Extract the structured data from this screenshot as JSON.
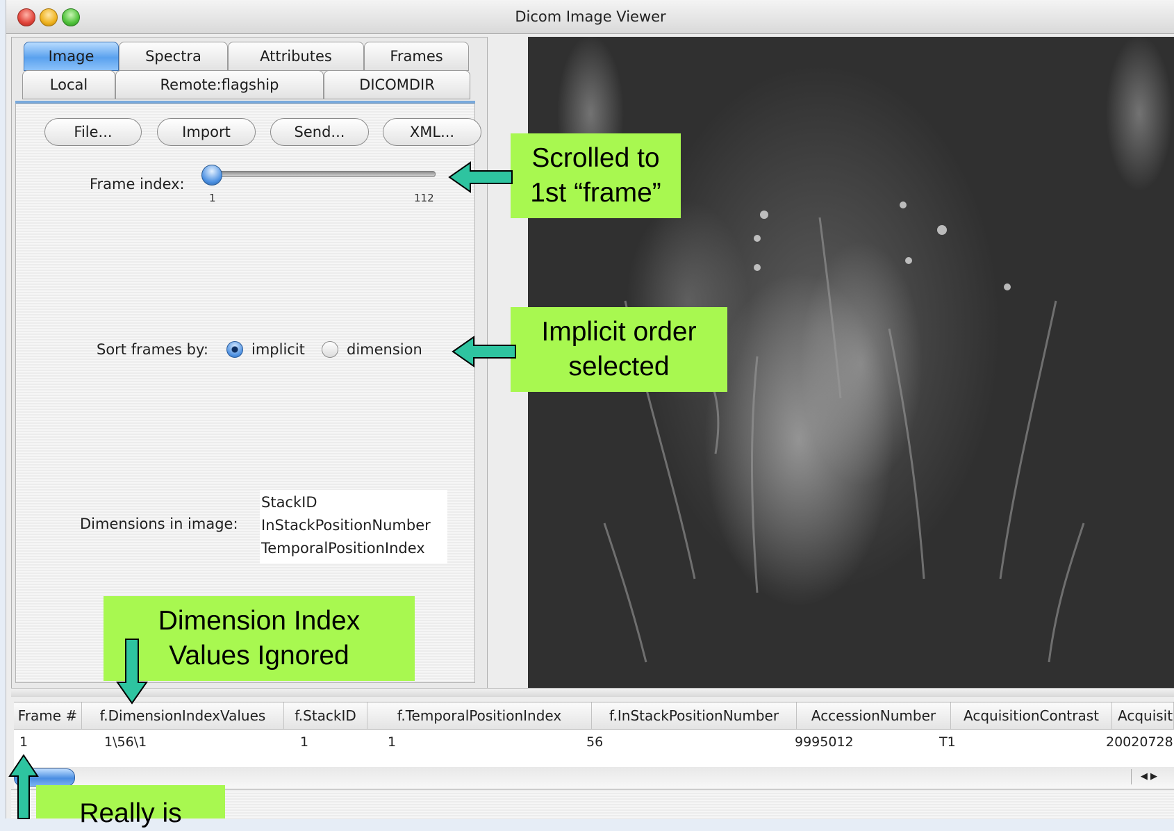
{
  "window": {
    "title": "Dicom Image Viewer"
  },
  "tabs": {
    "row1": [
      {
        "label": "Image",
        "active": true
      },
      {
        "label": "Spectra",
        "active": false
      },
      {
        "label": "Attributes",
        "active": false
      },
      {
        "label": "Frames",
        "active": false
      }
    ],
    "row2": [
      {
        "label": "Local"
      },
      {
        "label": "Remote:flagship"
      },
      {
        "label": "DICOMDIR"
      }
    ]
  },
  "toolbar": {
    "file_label": "File...",
    "import_label": "Import",
    "send_label": "Send...",
    "xml_label": "XML..."
  },
  "frame_slider": {
    "label": "Frame index:",
    "min": "1",
    "max": "112",
    "value": 1
  },
  "sort": {
    "label": "Sort frames by:",
    "options": [
      "implicit",
      "dimension"
    ],
    "selected": "implicit"
  },
  "dimensions": {
    "label": "Dimensions in image:",
    "items": [
      "StackID",
      "InStackPositionNumber",
      "TemporalPositionIndex"
    ]
  },
  "table": {
    "columns": [
      "Frame #",
      "f.DimensionIndexValues",
      "f.StackID",
      "f.TemporalPositionIndex",
      "f.InStackPositionNumber",
      "AccessionNumber",
      "AcquisitionContrast",
      "Acquisit"
    ],
    "rows": [
      [
        "1",
        "1\\56\\1",
        "1",
        "1",
        "56",
        "9995012",
        "T1",
        "20020728"
      ]
    ]
  },
  "callouts": {
    "frame": [
      "Scrolled to",
      "1st “frame”"
    ],
    "order": [
      "Implicit order",
      "selected"
    ],
    "dims": [
      "Dimension Index",
      "Values Ignored"
    ],
    "bottom": [
      "Really is"
    ]
  },
  "colors": {
    "callout_bg": "#a8f850",
    "arrow_fill": "#2ec4a0",
    "tab_active": "#5aa1ee"
  }
}
